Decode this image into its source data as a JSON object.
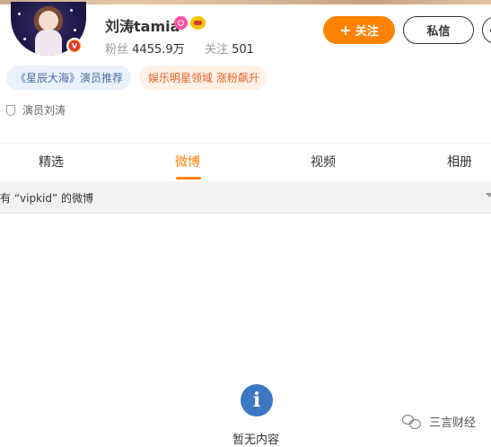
{
  "profile": {
    "name": "刘涛tamia",
    "verified_mark": "V",
    "fans_label": "粉丝",
    "fans_value": "4455.9万",
    "following_label": "关注",
    "following_value": "501"
  },
  "actions": {
    "follow_icon": "+",
    "follow_label": "关注",
    "message_label": "私信"
  },
  "tags": [
    {
      "label": "《星辰大海》演员推荐"
    },
    {
      "label": "娱乐明星领域 涨粉飙升"
    }
  ],
  "identity": {
    "icon": "shield-icon",
    "text": "演员刘涛"
  },
  "tabs": [
    {
      "label": "精选",
      "active": false
    },
    {
      "label": "微博",
      "active": true
    },
    {
      "label": "视频",
      "active": false
    },
    {
      "label": "相册",
      "active": false
    }
  ],
  "search_result": {
    "text": "有 “vipkid” 的微博"
  },
  "empty_state": {
    "icon": "info-icon",
    "icon_glyph": "i",
    "text": "暂无内容"
  },
  "watermark": {
    "icon": "wechat-icon",
    "text": "三言财经"
  },
  "colors": {
    "accent": "#ff8200",
    "tag_blue_text": "#4a6fa5",
    "tag_orange_text": "#e8632b",
    "info_icon": "#3d77c2"
  }
}
